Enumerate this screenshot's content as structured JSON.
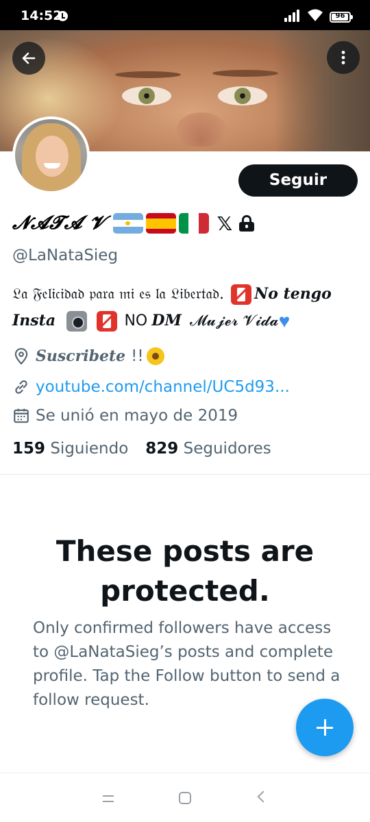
{
  "status_bar": {
    "time": "14:52",
    "battery": "96",
    "battery_level": 0.96,
    "icons": [
      "alarm-icon",
      "signal-icon",
      "wifi-icon",
      "battery-icon"
    ]
  },
  "header": {
    "back_icon": "arrow-left-icon",
    "more_icon": "more-vertical-icon"
  },
  "profile": {
    "display_name": "𝓝𝓐𝓣𝓐 𝓥",
    "flags": [
      "argentina-flag",
      "spain-flag",
      "italy-flag"
    ],
    "x_symbol": "𝕏",
    "protected_icon": "lock-icon",
    "handle": "@LaNataSieg",
    "follow_label": "Seguir",
    "bio": {
      "line1_gothic": "𝔏𝔞 𝔉𝔢𝔩𝔦𝔠𝔦𝔡𝔞𝔡 𝔭𝔞𝔯𝔞 𝔪𝔦 𝔢𝔰 𝔩𝔞 𝔏𝔦𝔟𝔢𝔯𝔱𝔞𝔡.",
      "no_tengo": "No tengo",
      "insta": "Insta",
      "no": "NO",
      "dm": "DM",
      "mujer_vida": "𝓜𝓾𝓳𝓮𝓻 𝓥𝓲𝓭𝓪"
    },
    "location": "Suscribete",
    "location_suffix": "!!",
    "website": "youtube.com/channel/UC5d93...",
    "joined": "Se unió en mayo de 2019",
    "following_count": "159",
    "following_label": "Siguiendo",
    "followers_count": "829",
    "followers_label": "Seguidores"
  },
  "protected": {
    "title": "These posts are protected.",
    "description": "Only confirmed followers have access to @LaNataSieg’s posts and complete profile. Tap the Follow button to send a follow request."
  },
  "fab": {
    "icon": "plus-icon"
  },
  "nav_bar": {
    "icons": [
      "menu-icon",
      "home-icon",
      "back-icon"
    ]
  },
  "colors": {
    "accent": "#1d9bf0",
    "text_primary": "#0f1419",
    "text_secondary": "#536471",
    "button_dark": "#0f1419"
  }
}
